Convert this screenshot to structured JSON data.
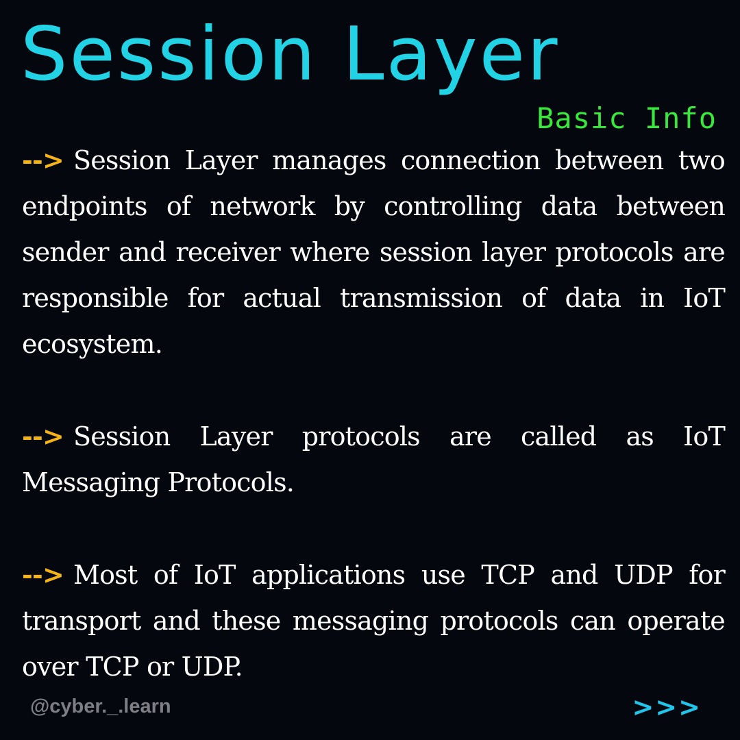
{
  "title": "Session Layer",
  "subtitle": "Basic Info",
  "paragraphs": [
    {
      "arrow": "-->",
      "text": "Session Layer manages connection between two endpoints of network by controlling data between sender and receiver where session layer protocols are responsible for actual transmission of data in IoT ecosystem."
    },
    {
      "arrow": "-->",
      "text": "Session Layer protocols are called as IoT Messaging Protocols."
    },
    {
      "arrow": "-->",
      "text": "Most of IoT applications use TCP and UDP for transport and these messaging protocols can operate over TCP or UDP."
    }
  ],
  "footer": {
    "handle": "@cyber._.learn",
    "next": ">>>"
  },
  "colors": {
    "background": "#05070f",
    "title": "#22d3e6",
    "subtitle": "#39e83c",
    "arrow": "#f5b416",
    "body_text": "#ffffff",
    "handle": "#7d7f85",
    "next": "#22c5ea"
  }
}
